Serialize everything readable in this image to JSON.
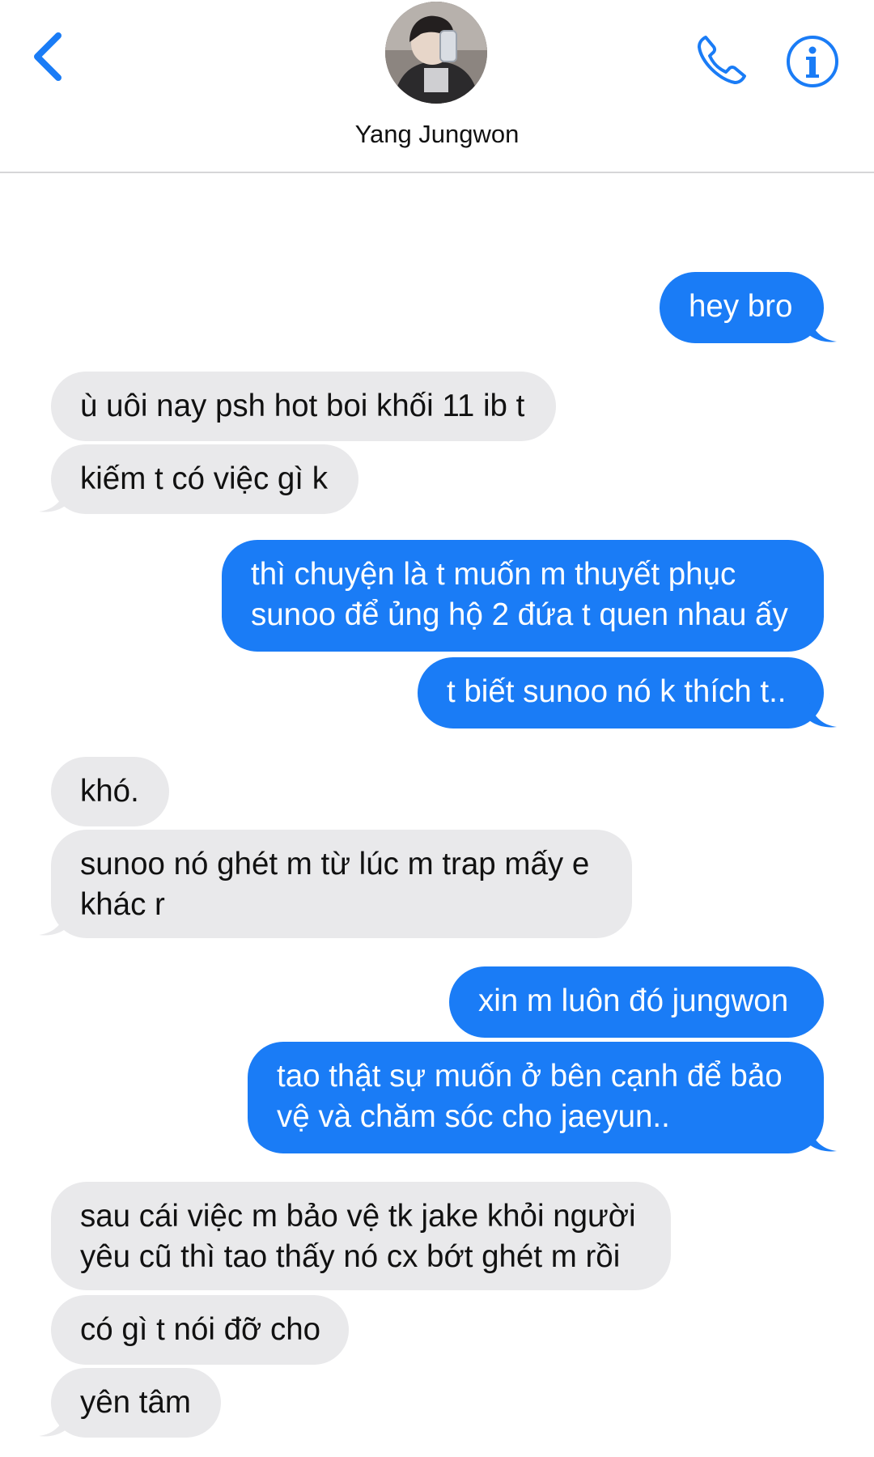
{
  "header": {
    "contact_name": "Yang Jungwon"
  },
  "icons": {
    "back": "chevron-left-icon",
    "call": "phone-icon",
    "info": "info-icon"
  },
  "colors": {
    "accent": "#1a7cf6",
    "incoming_bubble": "#e9e9eb"
  },
  "messages": [
    {
      "from": "me",
      "lines": [
        "hey bro"
      ]
    },
    {
      "from": "them",
      "lines": [
        "ù uôi nay psh hot boi khối 11 ib t"
      ]
    },
    {
      "from": "them",
      "lines": [
        "kiếm t có việc gì k"
      ]
    },
    {
      "from": "me",
      "lines": [
        "thì chuyện là t muốn m thuyết phục",
        "sunoo để ủng hộ 2 đứa t quen nhau ấy"
      ]
    },
    {
      "from": "me",
      "lines": [
        "t biết sunoo nó k thích t.."
      ]
    },
    {
      "from": "them",
      "lines": [
        "khó."
      ]
    },
    {
      "from": "them",
      "lines": [
        "sunoo nó ghét m từ lúc m trap mấy e",
        "khác r"
      ]
    },
    {
      "from": "me",
      "lines": [
        "xin m luôn đó jungwon"
      ]
    },
    {
      "from": "me",
      "lines": [
        "tao thật sự muốn ở bên cạnh để bảo",
        "vệ và chăm sóc cho jaeyun.."
      ]
    },
    {
      "from": "them",
      "lines": [
        "sau cái việc m bảo vệ tk jake khỏi người",
        "yêu cũ thì tao thấy nó cx bớt ghét m rồi"
      ]
    },
    {
      "from": "them",
      "lines": [
        "có gì t nói đỡ cho"
      ]
    },
    {
      "from": "them",
      "lines": [
        "yên tâm"
      ]
    }
  ]
}
